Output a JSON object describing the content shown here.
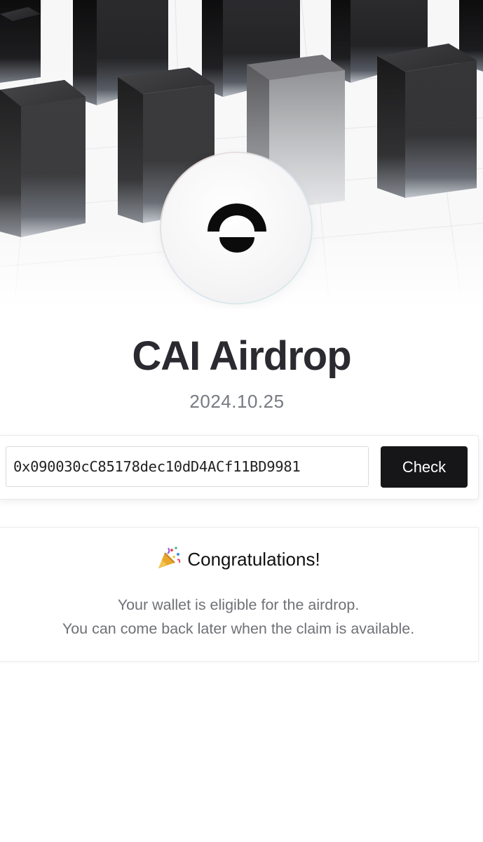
{
  "hero": {
    "logo": "cai-logo-icon"
  },
  "page": {
    "title": "CAI Airdrop",
    "date": "2024.10.25"
  },
  "checker": {
    "wallet_value": "0x090030cC85178dec10dD4ACf11BD9981",
    "button_label": "Check"
  },
  "result": {
    "icon": "party-popper-icon",
    "heading": "Congratulations!",
    "line1": "Your wallet is eligible for the airdrop.",
    "line2": "You can come back later when the claim is available."
  },
  "colors": {
    "button_bg": "#161618",
    "title": "#2a2a30",
    "muted_text": "#777a80"
  }
}
